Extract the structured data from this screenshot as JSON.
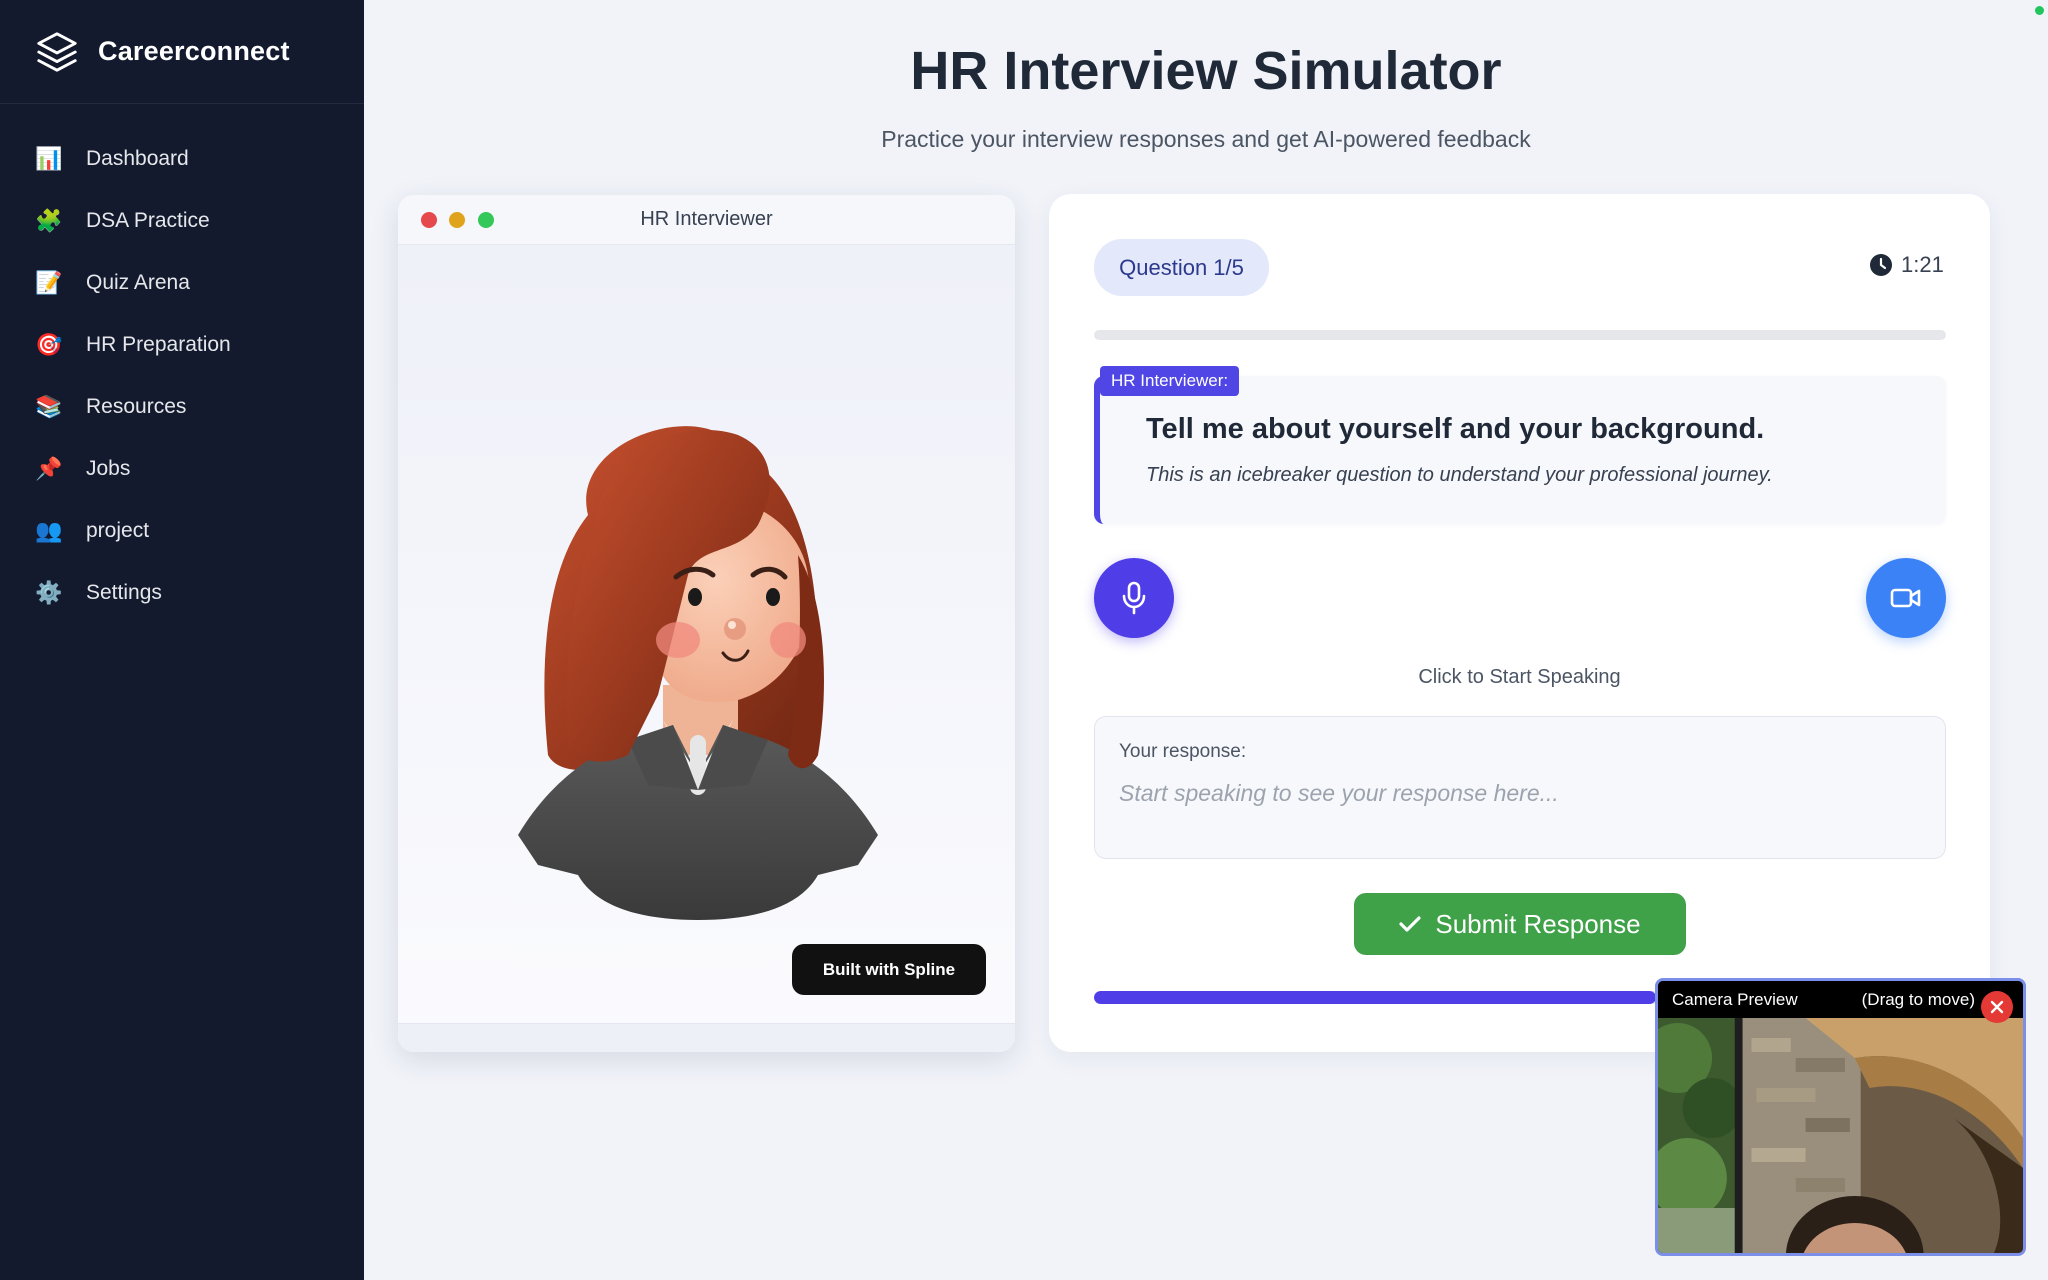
{
  "app": {
    "name": "Careerconnect"
  },
  "sidebar": {
    "items": [
      {
        "label": "Dashboard",
        "icon": "bar-chart-icon"
      },
      {
        "label": "DSA Practice",
        "icon": "puzzle-icon"
      },
      {
        "label": "Quiz Arena",
        "icon": "memo-icon"
      },
      {
        "label": "HR Preparation",
        "icon": "target-icon"
      },
      {
        "label": "Resources",
        "icon": "books-icon"
      },
      {
        "label": "Jobs",
        "icon": "pushpin-icon"
      },
      {
        "label": "project",
        "icon": "people-icon"
      },
      {
        "label": "Settings",
        "icon": "gear-icon"
      }
    ]
  },
  "header": {
    "title": "HR Interview Simulator",
    "subtitle": "Practice your interview responses and get AI-powered feedback"
  },
  "interviewer_window": {
    "title": "HR Interviewer",
    "badge": "Built with Spline"
  },
  "question_panel": {
    "badge": "Question 1/5",
    "timer": "1:21",
    "tag": "HR Interviewer:",
    "question": "Tell me about yourself and your background.",
    "hint": "This is an icebreaker question to understand your professional journey.",
    "speak_hint": "Click to Start Speaking",
    "response_label": "Your response:",
    "response_placeholder": "Start speaking to see your response here...",
    "submit_label": "Submit Response",
    "top_progress": 0,
    "bottom_progress": 0.66
  },
  "camera_preview": {
    "title": "Camera Preview",
    "drag_hint": "(Drag to move)"
  },
  "colors": {
    "sidebar_bg": "#141a2e",
    "accent": "#4f3de8",
    "camera_button": "#3b82f6",
    "submit": "#3fa148",
    "close": "#e53935"
  }
}
